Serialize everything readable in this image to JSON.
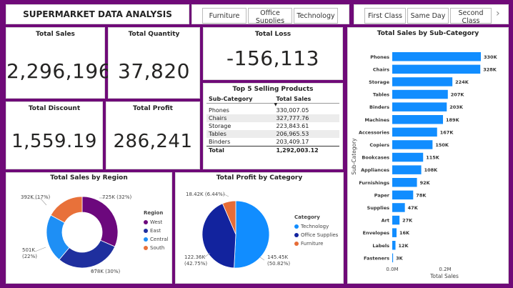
{
  "title": "SUPERMARKET DATA ANALYSIS",
  "category_slicer": [
    "Furniture",
    "Office Supplies",
    "Technology"
  ],
  "shipmode_slicer": [
    "First Class",
    "Same Day",
    "Second Class"
  ],
  "slicer_arrow": "›",
  "kpis": {
    "total_sales": {
      "label": "Total Sales",
      "value": "2,296,196"
    },
    "total_quantity": {
      "label": "Total Quantity",
      "value": "37,820"
    },
    "total_loss": {
      "label": "Total Loss",
      "value": "-156,113"
    },
    "total_discount": {
      "label": "Total Discount",
      "value": "1,559.19"
    },
    "total_profit": {
      "label": "Total Profit",
      "value": "286,241"
    }
  },
  "top5": {
    "title": "Top 5 Selling Products",
    "headers": [
      "Sub-Category",
      "Total Sales"
    ],
    "rows": [
      [
        "Phones",
        "330,007.05"
      ],
      [
        "Chairs",
        "327,777.76"
      ],
      [
        "Storage",
        "223,843.61"
      ],
      [
        "Tables",
        "206,965.53"
      ],
      [
        "Binders",
        "203,409.17"
      ]
    ],
    "total": [
      "Total",
      "1,292,003.12"
    ]
  },
  "colors": {
    "west": "#6c087d",
    "east": "#1f2f9e",
    "central": "#1e8ff5",
    "south": "#e8713a",
    "technology": "#118dff",
    "office_supplies": "#12239e",
    "furniture": "#e66c37",
    "bar": "#118dff"
  },
  "region_chart": {
    "title": "Total Sales by Region",
    "legend_title": "Region",
    "labels": {
      "west": "725K (32%)",
      "east": "678K (30%)",
      "central_l1": "501K",
      "central_l2": "(22%)",
      "south": "392K (17%)"
    },
    "chart_data": {
      "type": "pie",
      "categories": [
        "West",
        "East",
        "Central",
        "South"
      ],
      "values": [
        725,
        678,
        501,
        392
      ]
    }
  },
  "profit_chart": {
    "title": "Total Profit by Category",
    "legend_title": "Category",
    "labels": {
      "tech_l1": "145.45K",
      "tech_l2": "(50.82%)",
      "office_l1": "122.36K",
      "office_l2": "(42.75%)",
      "furn": "18.42K (6.44%)"
    },
    "chart_data": {
      "type": "pie",
      "categories": [
        "Technology",
        "Office Supplies",
        "Furniture"
      ],
      "values": [
        145.45,
        122.36,
        18.42
      ]
    }
  },
  "subcat_chart": {
    "title": "Total Sales by Sub-Category",
    "ylabel": "Sub-Category",
    "xlabel": "Total Sales",
    "xticks": [
      "0.0M",
      "0.2M"
    ],
    "chart_data": {
      "type": "bar",
      "categories": [
        "Phones",
        "Chairs",
        "Storage",
        "Tables",
        "Binders",
        "Machines",
        "Accessories",
        "Copiers",
        "Bookcases",
        "Appliances",
        "Furnishings",
        "Paper",
        "Supplies",
        "Art",
        "Envelopes",
        "Labels",
        "Fasteners"
      ],
      "values": [
        330,
        328,
        224,
        207,
        203,
        189,
        167,
        150,
        115,
        108,
        92,
        78,
        47,
        27,
        16,
        12,
        3
      ],
      "labels": [
        "330K",
        "328K",
        "224K",
        "207K",
        "203K",
        "189K",
        "167K",
        "150K",
        "115K",
        "108K",
        "92K",
        "78K",
        "47K",
        "27K",
        "16K",
        "12K",
        "3K"
      ]
    }
  }
}
